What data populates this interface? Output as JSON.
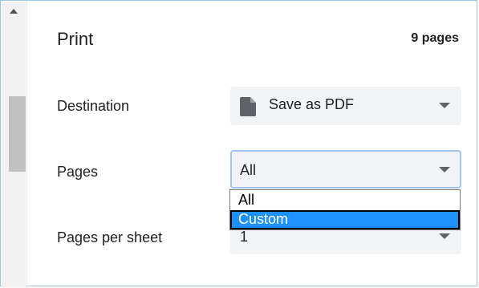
{
  "header": {
    "title": "Print",
    "page_count": "9 pages"
  },
  "destination": {
    "label": "Destination",
    "value": "Save as PDF",
    "icon": "document-icon"
  },
  "pages": {
    "label": "Pages",
    "value": "All",
    "options": [
      "All",
      "Custom"
    ],
    "highlighted_option": "Custom"
  },
  "pages_per_sheet": {
    "label": "Pages per sheet",
    "value": "1"
  },
  "colors": {
    "accent": "#1e90ff",
    "focus_border": "#a1c4f3",
    "select_bg": "#f1f3f4",
    "text": "#202124"
  }
}
